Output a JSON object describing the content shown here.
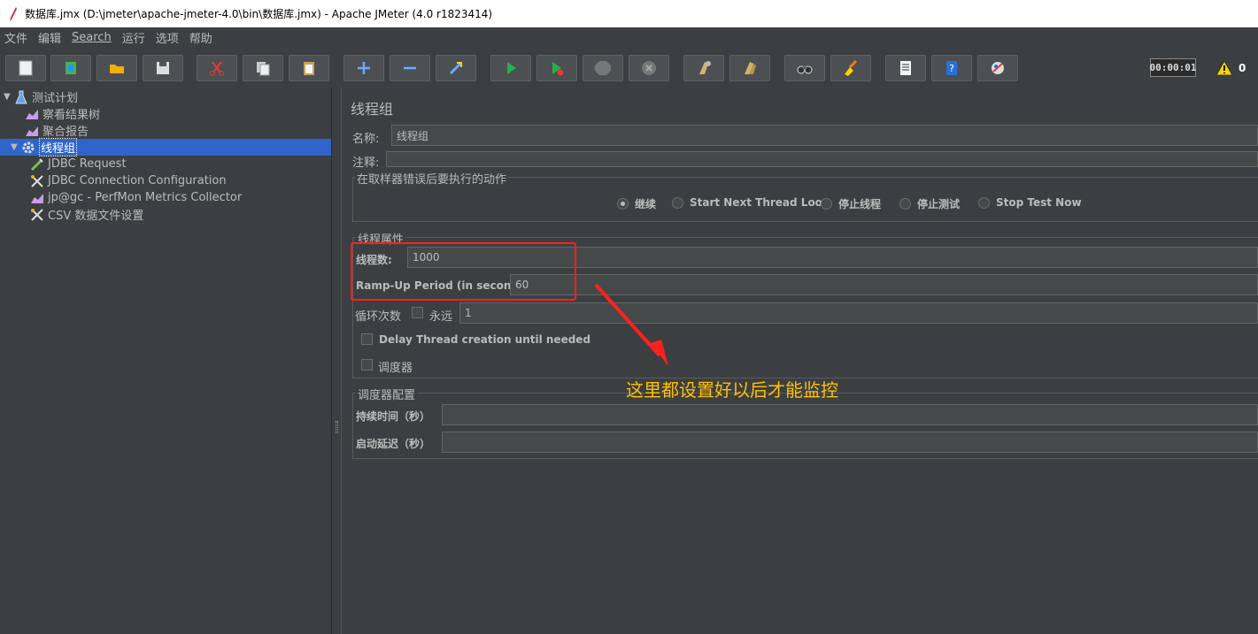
{
  "window": {
    "title": "数据库.jmx (D:\\jmeter\\apache-jmeter-4.0\\bin\\数据库.jmx) - Apache JMeter (4.0 r1823414)"
  },
  "menu": [
    "文件",
    "编辑",
    "Search",
    "运行",
    "选项",
    "帮助"
  ],
  "toolbar": {
    "buttons": [
      "new-icon",
      "templates-icon",
      "open-icon",
      "save-icon",
      "cut-icon",
      "copy-icon",
      "paste-icon",
      "expand-icon",
      "collapse-icon",
      "toggle-icon",
      "start-icon",
      "start-no-pause-icon",
      "stop-icon",
      "shutdown-icon",
      "clear-icon",
      "clear-all-icon",
      "search-icon",
      "reset-search-icon",
      "function-helper-icon",
      "help-icon",
      "remote-icon"
    ],
    "timer": "00:00:01",
    "warning_count": "0"
  },
  "tree": {
    "root": "测试计划",
    "items": [
      {
        "label": "察看结果树",
        "icon": "listener-icon"
      },
      {
        "label": "聚合报告",
        "icon": "listener-icon"
      },
      {
        "label": "线程组",
        "icon": "gear-icon"
      },
      {
        "label": "JDBC Request",
        "icon": "sampler-icon"
      },
      {
        "label": "JDBC Connection Configuration",
        "icon": "config-icon"
      },
      {
        "label": "jp@gc - PerfMon Metrics Collector",
        "icon": "listener-icon"
      },
      {
        "label": "CSV 数据文件设置",
        "icon": "config-icon"
      }
    ]
  },
  "panel": {
    "title": "线程组",
    "name_label": "名称:",
    "name_value": "线程组",
    "comment_label": "注释:",
    "comment_value": "",
    "error_action": {
      "legend": "在取样器错误后要执行的动作",
      "options": [
        "继续",
        "Start Next Thread Loop",
        "停止线程",
        "停止测试",
        "Stop Test Now"
      ],
      "selected": 0
    },
    "thread_props": {
      "legend": "线程属性",
      "threads_label": "线程数:",
      "threads_value": "1000",
      "rampup_label": "Ramp-Up Period (in seconds):",
      "rampup_value": "60",
      "loop_label": "循环次数",
      "forever_label": "永远",
      "loop_value": "1",
      "delay_label": "Delay Thread creation until needed",
      "scheduler_label": "调度器"
    },
    "scheduler_config": {
      "legend": "调度器配置",
      "duration_label": "持续时间（秒）",
      "duration_value": "",
      "startup_label": "启动延迟（秒）",
      "startup_value": ""
    }
  },
  "annotation": "这里都设置好以后才能监控",
  "colors": {
    "accent_annotation": "#ffc000",
    "highlight_box": "#ff2020",
    "tree_selection": "#2f65ca"
  }
}
